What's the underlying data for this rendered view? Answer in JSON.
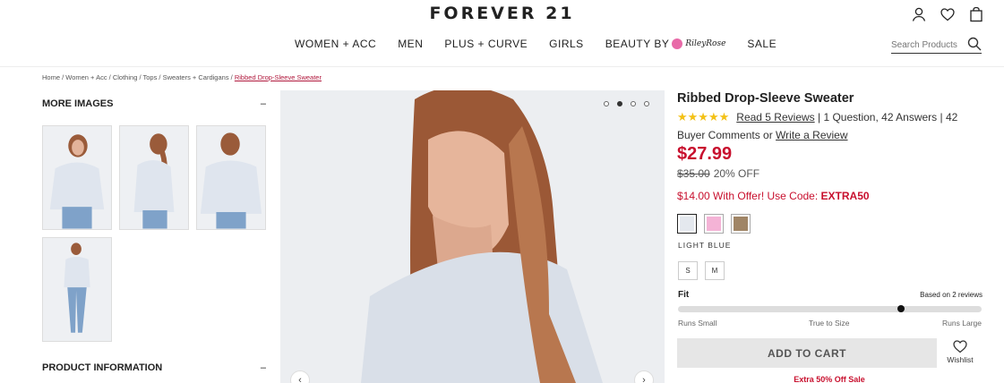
{
  "header": {
    "logo": "FOREVER 21",
    "icons": [
      "account-icon",
      "heart-icon",
      "bag-icon"
    ],
    "nav": [
      "WOMEN + ACC",
      "MEN",
      "PLUS + CURVE",
      "GIRLS"
    ],
    "nav_beauty": "BEAUTY BY",
    "nav_beauty_brand": "RileyRose",
    "nav_sale": "SALE",
    "search_placeholder": "Search Products"
  },
  "breadcrumb": {
    "path": "Home / Women + Acc / Clothing / Tops / Sweaters + Cardigans /",
    "current": "Ribbed Drop-Sleeve Sweater"
  },
  "left": {
    "more_images": "MORE IMAGES",
    "product_info": "PRODUCT INFORMATION",
    "toggle": "–"
  },
  "gallery": {
    "dot_count": 4,
    "active_dot": 2,
    "prev": "‹",
    "next": "›"
  },
  "product": {
    "title": "Ribbed Drop-Sleeve Sweater",
    "stars": "★★★★★",
    "reviews_link": "Read 5 Reviews",
    "qa_text": " | 1 Question, 42 Answers | 42",
    "buyer_text": "Buyer Comments or ",
    "write_review": "Write a Review",
    "price": "$27.99",
    "original_price": "$35.00",
    "discount": "20% OFF",
    "offer_text": "$14.00 With Offer! Use Code: ",
    "offer_code": "EXTRA50",
    "color_name": "LIGHT BLUE",
    "colors": [
      "#e4e8ee",
      "#f4b3d6",
      "#a08566"
    ],
    "sizes": [
      "S",
      "M"
    ],
    "fit_label": "Fit",
    "fit_based": "Based on 2 reviews",
    "fit_value": 0.74,
    "fit_small": "Runs Small",
    "fit_true": "True to Size",
    "fit_large": "Runs Large",
    "add_to_cart": "ADD TO CART",
    "wishlist": "Wishlist",
    "promo": "Extra 50% Off Sale"
  }
}
